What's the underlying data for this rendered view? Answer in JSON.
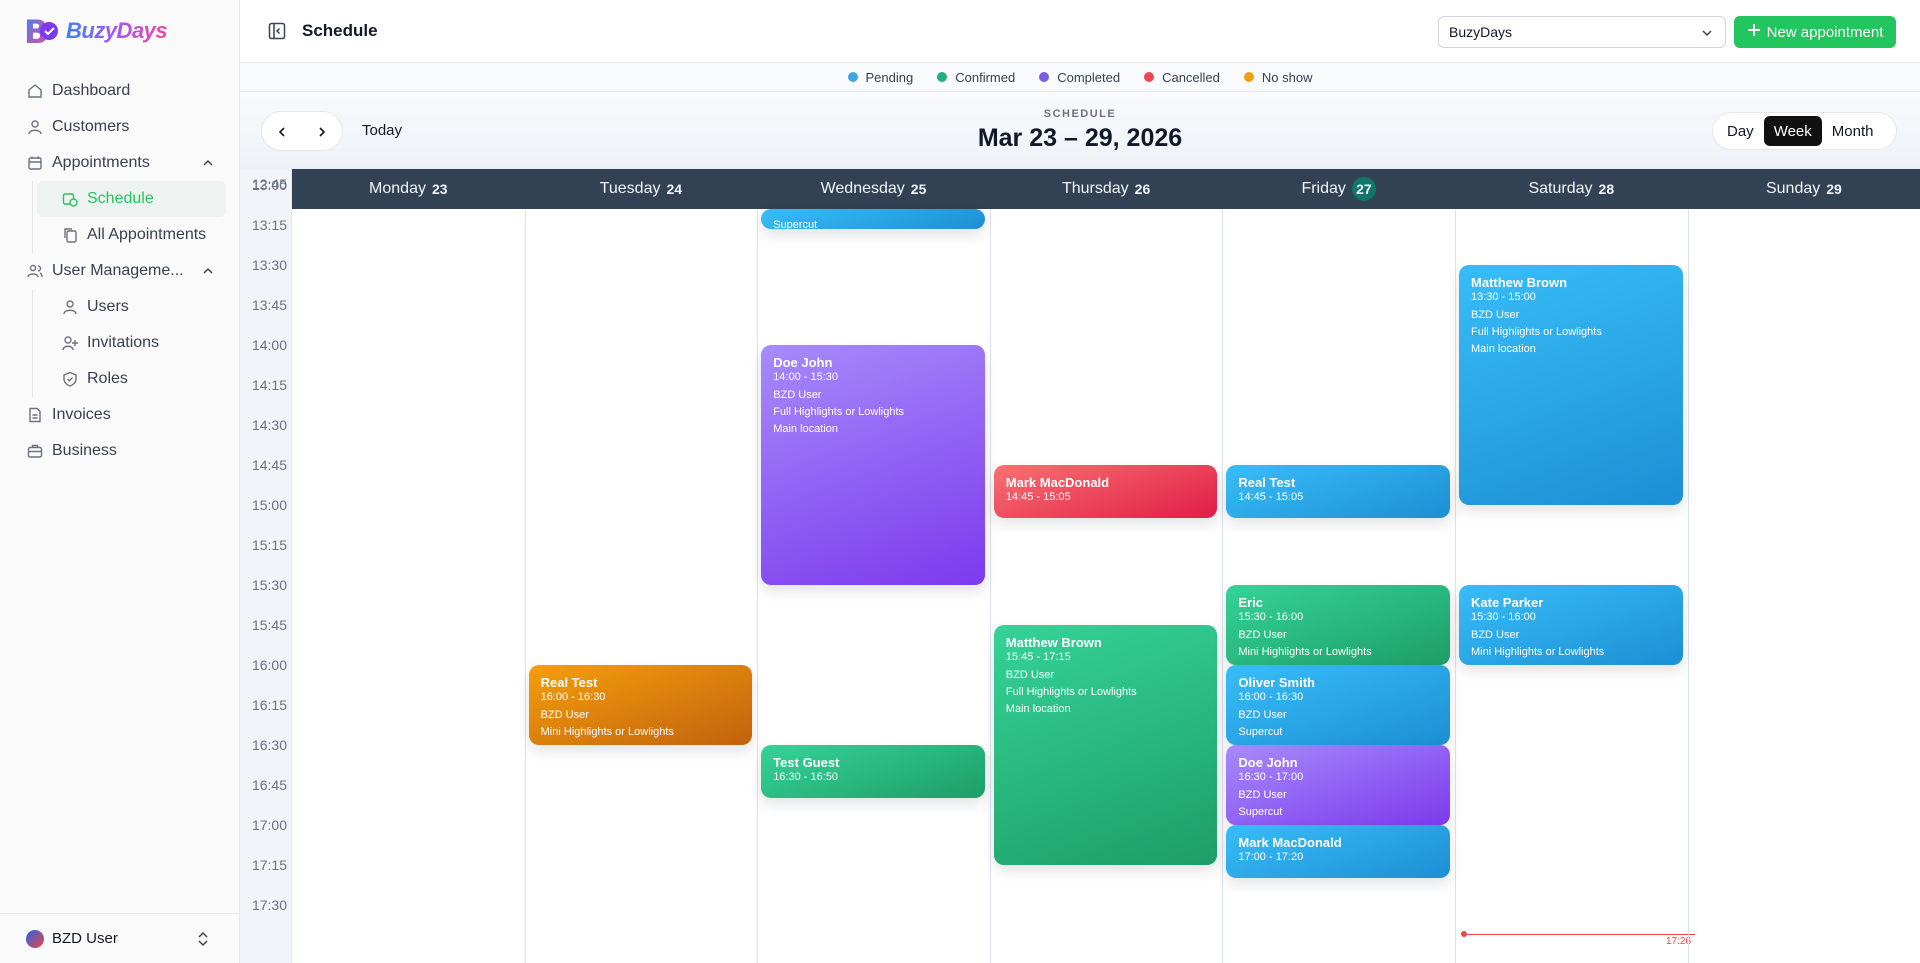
{
  "brand": {
    "name": "BuzyDays"
  },
  "sidebar": {
    "items": [
      {
        "label": "Dashboard",
        "icon": "home-icon"
      },
      {
        "label": "Customers",
        "icon": "user-icon"
      },
      {
        "label": "Appointments",
        "icon": "calendar-icon",
        "expanded": true,
        "children": [
          {
            "label": "Schedule",
            "icon": "calendar-clock-icon",
            "active": true
          },
          {
            "label": "All Appointments",
            "icon": "copy-icon"
          }
        ]
      },
      {
        "label": "User Manageme...",
        "icon": "users-icon",
        "expanded": true,
        "children": [
          {
            "label": "Users",
            "icon": "user-icon"
          },
          {
            "label": "Invitations",
            "icon": "user-plus-icon"
          },
          {
            "label": "Roles",
            "icon": "shield-icon"
          }
        ]
      },
      {
        "label": "Invoices",
        "icon": "file-icon"
      },
      {
        "label": "Business",
        "icon": "briefcase-icon"
      }
    ],
    "footer_user": "BZD User"
  },
  "topbar": {
    "title": "Schedule",
    "business_select": "BuzyDays",
    "new_button": "New appointment"
  },
  "legend": [
    {
      "label": "Pending",
      "color": "#3ea6e3"
    },
    {
      "label": "Confirmed",
      "color": "#22b07d"
    },
    {
      "label": "Completed",
      "color": "#7c5ce6"
    },
    {
      "label": "Cancelled",
      "color": "#ef4456"
    },
    {
      "label": "No show",
      "color": "#f59e0b"
    }
  ],
  "calendar": {
    "kicker": "SCHEDULE",
    "range": "Mar 23 – 29, 2026",
    "today_label": "Today",
    "views": [
      "Day",
      "Week",
      "Month"
    ],
    "selected_view": "Week",
    "days": [
      {
        "name": "Monday",
        "num": "23"
      },
      {
        "name": "Tuesday",
        "num": "24"
      },
      {
        "name": "Wednesday",
        "num": "25"
      },
      {
        "name": "Thursday",
        "num": "26"
      },
      {
        "name": "Friday",
        "num": "27",
        "today": true
      },
      {
        "name": "Saturday",
        "num": "28"
      },
      {
        "name": "Sunday",
        "num": "29"
      }
    ],
    "times": [
      "12:45",
      "13:00",
      "13:15",
      "13:30",
      "13:45",
      "14:00",
      "14:15",
      "14:30",
      "14:45",
      "15:00",
      "15:15",
      "15:30",
      "15:45",
      "16:00",
      "16:15",
      "16:30",
      "16:45",
      "17:00",
      "17:15",
      "17:30"
    ],
    "now_time": "17:26",
    "appointments": [
      {
        "day": 2,
        "name": "",
        "time": "",
        "lines": [
          "Supercut"
        ],
        "status": "Pending",
        "start": "12:40",
        "end": "13:00",
        "style": "blue"
      },
      {
        "day": 2,
        "name": "Doe John",
        "time": "14:00 - 15:30",
        "lines": [
          "BZD User",
          "Full Highlights or Lowlights",
          "Main location"
        ],
        "status": "Completed",
        "start": "14:00",
        "end": "15:30",
        "style": "purple"
      },
      {
        "day": 2,
        "name": "Test Guest",
        "time": "16:30 - 16:50",
        "lines": [],
        "status": "Confirmed",
        "start": "16:30",
        "end": "16:50",
        "style": "green"
      },
      {
        "day": 1,
        "name": "Real Test",
        "time": "16:00 - 16:30",
        "lines": [
          "BZD User",
          "Mini Highlights or Lowlights"
        ],
        "status": "No show",
        "start": "16:00",
        "end": "16:30",
        "style": "orange"
      },
      {
        "day": 3,
        "name": "Mark MacDonald",
        "time": "14:45 - 15:05",
        "lines": [],
        "status": "Cancelled",
        "start": "14:45",
        "end": "15:05",
        "style": "red"
      },
      {
        "day": 3,
        "name": "Matthew Brown",
        "time": "15:45 - 17:15",
        "lines": [
          "BZD User",
          "Full Highlights or Lowlights",
          "Main location"
        ],
        "status": "Confirmed",
        "start": "15:45",
        "end": "17:15",
        "style": "green"
      },
      {
        "day": 4,
        "name": "Real Test",
        "time": "14:45 - 15:05",
        "lines": [],
        "status": "Pending",
        "start": "14:45",
        "end": "15:05",
        "style": "blue"
      },
      {
        "day": 4,
        "name": "Eric",
        "time": "15:30 - 16:00",
        "lines": [
          "BZD User",
          "Mini Highlights or Lowlights"
        ],
        "status": "Confirmed",
        "start": "15:30",
        "end": "16:00",
        "style": "green"
      },
      {
        "day": 4,
        "name": "Oliver Smith",
        "time": "16:00 - 16:30",
        "lines": [
          "BZD User",
          "Supercut"
        ],
        "status": "Pending",
        "start": "16:00",
        "end": "16:30",
        "style": "blue"
      },
      {
        "day": 4,
        "name": "Doe John",
        "time": "16:30 - 17:00",
        "lines": [
          "BZD User",
          "Supercut"
        ],
        "status": "Completed",
        "start": "16:30",
        "end": "17:00",
        "style": "purple"
      },
      {
        "day": 4,
        "name": "Mark MacDonald",
        "time": "17:00 - 17:20",
        "lines": [],
        "status": "Pending",
        "start": "17:00",
        "end": "17:20",
        "style": "blue"
      },
      {
        "day": 5,
        "name": "Matthew Brown",
        "time": "13:30 - 15:00",
        "lines": [
          "BZD User",
          "Full Highlights or Lowlights",
          "Main location"
        ],
        "status": "Pending",
        "start": "13:30",
        "end": "15:00",
        "style": "blue"
      },
      {
        "day": 5,
        "name": "Kate Parker",
        "time": "15:30 - 16:00",
        "lines": [
          "BZD User",
          "Mini Highlights or Lowlights"
        ],
        "status": "Pending",
        "start": "15:30",
        "end": "16:00",
        "style": "blue"
      }
    ]
  }
}
